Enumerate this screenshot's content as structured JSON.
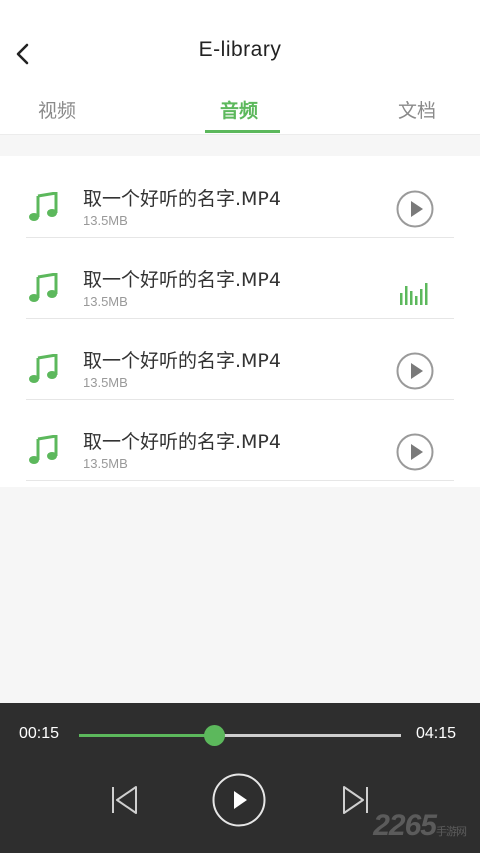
{
  "header": {
    "title": "E-library",
    "back_icon": "chevron-left-icon"
  },
  "tabs": [
    {
      "label": "视频",
      "active": false
    },
    {
      "label": "音频",
      "active": true
    },
    {
      "label": "文档",
      "active": false
    }
  ],
  "accent_color": "#5cb85c",
  "items": [
    {
      "name": "取一个好听的名字.MP4",
      "size": "13.5MB",
      "icon": "music-note-icon",
      "state": "play"
    },
    {
      "name": "取一个好听的名字.MP4",
      "size": "13.5MB",
      "icon": "music-note-icon",
      "state": "playing"
    },
    {
      "name": "取一个好听的名字.MP4",
      "size": "13.5MB",
      "icon": "music-note-icon",
      "state": "play"
    },
    {
      "name": "取一个好听的名字.MP4",
      "size": "13.5MB",
      "icon": "music-note-icon",
      "state": "play"
    }
  ],
  "player": {
    "current_time": "00:15",
    "total_time": "04:15",
    "progress": 0.42,
    "controls": [
      "previous-icon",
      "play-icon",
      "next-icon"
    ]
  },
  "watermark": {
    "text": "2265",
    "sub": "手游网"
  }
}
